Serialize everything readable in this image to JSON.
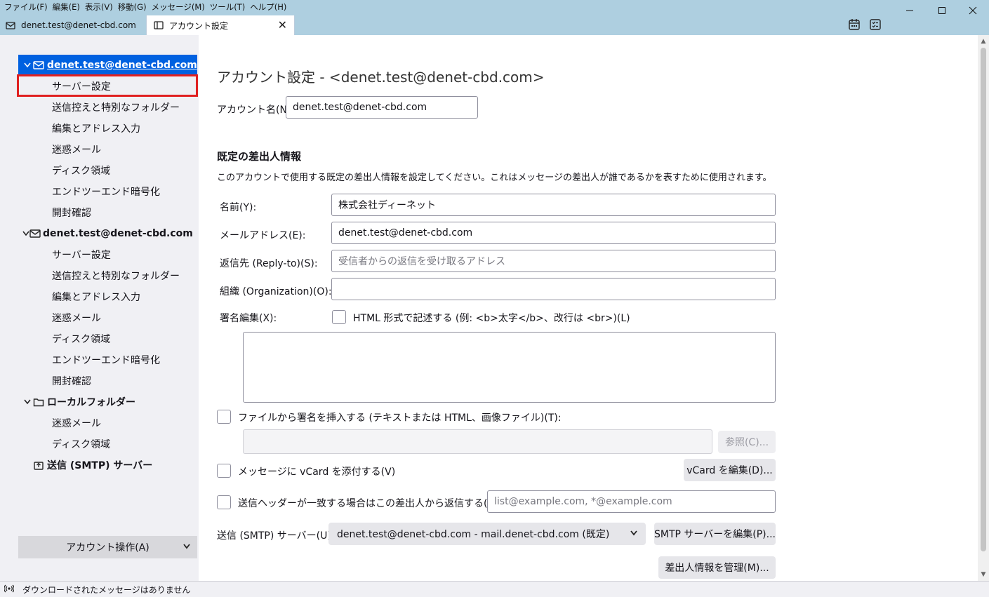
{
  "menubar": [
    "ファイル(F)",
    "編集(E)",
    "表示(V)",
    "移動(G)",
    "メッセージ(M)",
    "ツール(T)",
    "ヘルプ(H)"
  ],
  "tabs": {
    "mail": "denet.test@denet-cbd.com",
    "account_settings": "アカウント設定",
    "close": "✕"
  },
  "window_controls": {
    "minimize": "minimize",
    "maximize": "maximize",
    "close": "close"
  },
  "sidebar": {
    "accounts": [
      {
        "label": "denet.test@denet-cbd.com",
        "icon": "envelope-icon",
        "items": [
          "サーバー設定",
          "送信控えと特別なフォルダー",
          "編集とアドレス入力",
          "迷惑メール",
          "ディスク領域",
          "エンドツーエンド暗号化",
          "開封確認"
        ]
      },
      {
        "label": "denet.test@denet-cbd.com (...",
        "icon": "envelope-icon",
        "items": [
          "サーバー設定",
          "送信控えと特別なフォルダー",
          "編集とアドレス入力",
          "迷惑メール",
          "ディスク領域",
          "エンドツーエンド暗号化",
          "開封確認"
        ]
      },
      {
        "label": "ローカルフォルダー",
        "icon": "folder-icon",
        "items": [
          "迷惑メール",
          "ディスク領域"
        ]
      }
    ],
    "smtp": "送信 (SMTP) サーバー",
    "account_actions": "アカウント操作(A)"
  },
  "main": {
    "title": "アカウント設定 - <denet.test@denet-cbd.com>",
    "account_name_label": "アカウント名(N):",
    "account_name_value": "denet.test@denet-cbd.com",
    "identity_heading": "既定の差出人情報",
    "identity_desc": "このアカウントで使用する既定の差出人情報を設定してください。これはメッセージの差出人が誰であるかを表すために使用されます。",
    "name_label": "名前(Y):",
    "name_value": "株式会社ディーネット",
    "email_label": "メールアドレス(E):",
    "email_value": "denet.test@denet-cbd.com",
    "replyto_label": "返信先 (Reply-to)(S):",
    "replyto_placeholder": "受信者からの返信を受け取るアドレス",
    "org_label": "組織 (Organization)(O):",
    "org_value": "",
    "signature_label": "署名編集(X):",
    "html_checkbox_label": "HTML 形式で記述する (例: <b>太字</b>、改行は <br>)(L)",
    "sig_file_label": "ファイルから署名を挿入する (テキストまたは HTML、画像ファイル)(T):",
    "browse_button": "参照(C)...",
    "vcard_label": "メッセージに vCard を添付する(V)",
    "vcard_edit_button": "vCard を編集(D)...",
    "reply_header_label": "送信ヘッダーが一致する場合はこの差出人から返信する(D):",
    "reply_header_placeholder": "list@example.com, *@example.com",
    "smtp_label": "送信 (SMTP) サーバー(U):",
    "smtp_value": "denet.test@denet-cbd.com - mail.denet-cbd.com (既定)",
    "smtp_edit_button": "SMTP サーバーを編集(P)...",
    "manage_identities_button": "差出人情報を管理(M)..."
  },
  "statusbar": {
    "text": "ダウンロードされたメッセージはありません"
  }
}
